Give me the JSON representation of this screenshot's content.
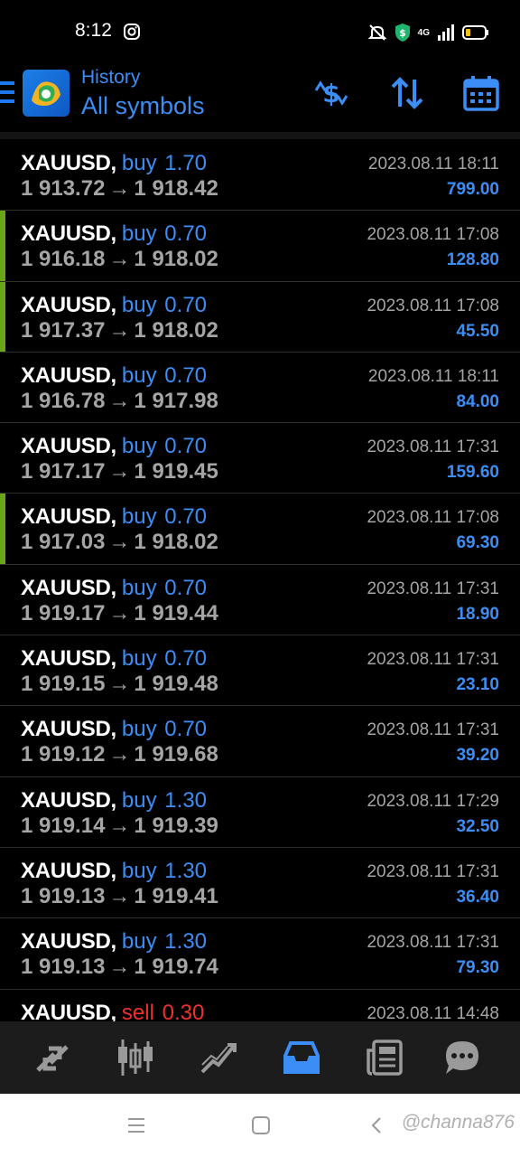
{
  "status_bar": {
    "time": "8:12",
    "network": "4G",
    "icons": [
      "instagram-icon",
      "mute-icon",
      "shield-icon",
      "signal-icon",
      "battery-icon"
    ]
  },
  "header": {
    "subtitle": "History",
    "title": "All symbols",
    "actions": [
      "currency-icon",
      "sort-icon",
      "calendar-icon"
    ],
    "accent_color": "#3b8ef5"
  },
  "deals": [
    {
      "symbol": "XAUUSD,",
      "side": "buy",
      "volume": "1.70",
      "open": "1 913.72",
      "close": "1 918.42",
      "time": "2023.08.11 18:11",
      "profit": "799.00",
      "marked": false
    },
    {
      "symbol": "XAUUSD,",
      "side": "buy",
      "volume": "0.70",
      "open": "1 916.18",
      "close": "1 918.02",
      "time": "2023.08.11 17:08",
      "profit": "128.80",
      "marked": true
    },
    {
      "symbol": "XAUUSD,",
      "side": "buy",
      "volume": "0.70",
      "open": "1 917.37",
      "close": "1 918.02",
      "time": "2023.08.11 17:08",
      "profit": "45.50",
      "marked": true
    },
    {
      "symbol": "XAUUSD,",
      "side": "buy",
      "volume": "0.70",
      "open": "1 916.78",
      "close": "1 917.98",
      "time": "2023.08.11 18:11",
      "profit": "84.00",
      "marked": false
    },
    {
      "symbol": "XAUUSD,",
      "side": "buy",
      "volume": "0.70",
      "open": "1 917.17",
      "close": "1 919.45",
      "time": "2023.08.11 17:31",
      "profit": "159.60",
      "marked": false
    },
    {
      "symbol": "XAUUSD,",
      "side": "buy",
      "volume": "0.70",
      "open": "1 917.03",
      "close": "1 918.02",
      "time": "2023.08.11 17:08",
      "profit": "69.30",
      "marked": true
    },
    {
      "symbol": "XAUUSD,",
      "side": "buy",
      "volume": "0.70",
      "open": "1 919.17",
      "close": "1 919.44",
      "time": "2023.08.11 17:31",
      "profit": "18.90",
      "marked": false
    },
    {
      "symbol": "XAUUSD,",
      "side": "buy",
      "volume": "0.70",
      "open": "1 919.15",
      "close": "1 919.48",
      "time": "2023.08.11 17:31",
      "profit": "23.10",
      "marked": false
    },
    {
      "symbol": "XAUUSD,",
      "side": "buy",
      "volume": "0.70",
      "open": "1 919.12",
      "close": "1 919.68",
      "time": "2023.08.11 17:31",
      "profit": "39.20",
      "marked": false
    },
    {
      "symbol": "XAUUSD,",
      "side": "buy",
      "volume": "1.30",
      "open": "1 919.14",
      "close": "1 919.39",
      "time": "2023.08.11 17:29",
      "profit": "32.50",
      "marked": false
    },
    {
      "symbol": "XAUUSD,",
      "side": "buy",
      "volume": "1.30",
      "open": "1 919.13",
      "close": "1 919.41",
      "time": "2023.08.11 17:31",
      "profit": "36.40",
      "marked": false
    },
    {
      "symbol": "XAUUSD,",
      "side": "buy",
      "volume": "1.30",
      "open": "1 919.13",
      "close": "1 919.74",
      "time": "2023.08.11 17:31",
      "profit": "79.30",
      "marked": false
    },
    {
      "symbol": "XAUUSD,",
      "side": "sell",
      "volume": "0.30",
      "open": "",
      "close": "",
      "time": "2023.08.11 14:48",
      "profit": "",
      "marked": false
    }
  ],
  "arrow_glyph": "→",
  "bottom_nav": {
    "items": [
      "quotes-icon",
      "chart-icon",
      "trade-icon",
      "history-icon",
      "news-icon",
      "chat-icon"
    ],
    "active": "history-icon"
  },
  "system_nav": {
    "watermark": "@channa876",
    "icons": [
      "recents-icon",
      "home-icon",
      "back-icon"
    ]
  },
  "colors": {
    "buy": "#3b8ef5",
    "sell": "#f0302a",
    "marker": "#6aa51a",
    "muted": "#a5a5a5"
  }
}
